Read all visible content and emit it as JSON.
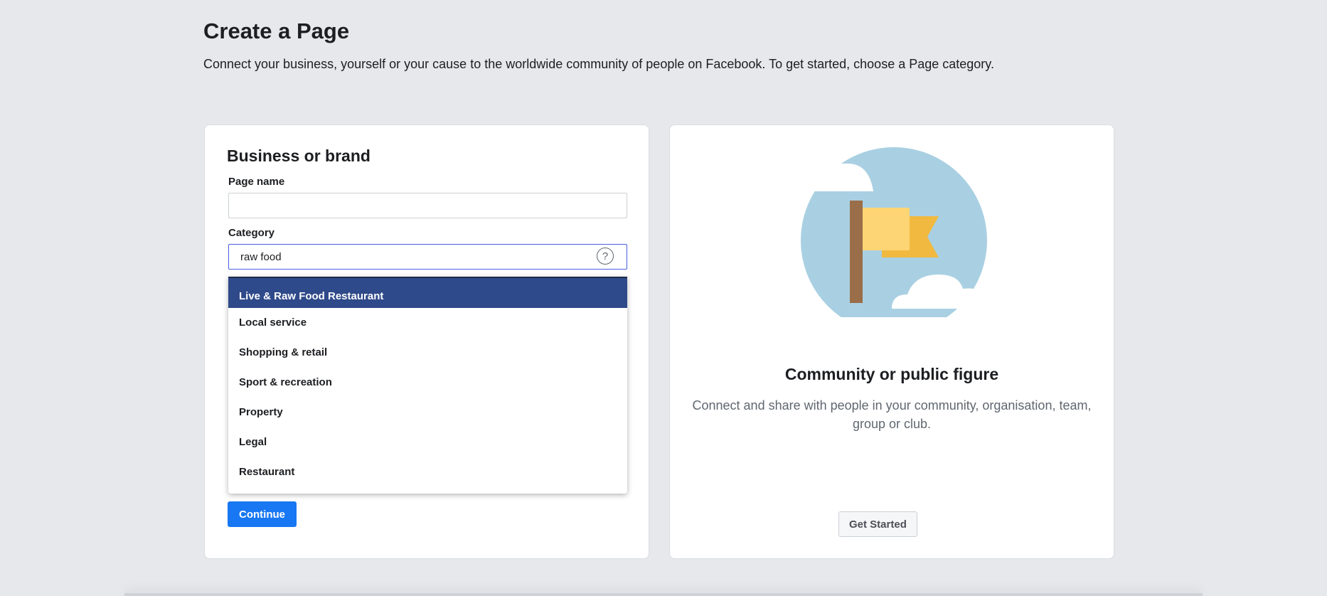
{
  "header": {
    "title": "Create a Page",
    "subtitle": "Connect your business, yourself or your cause to the worldwide community of people on Facebook. To get started, choose a Page category."
  },
  "business_card": {
    "heading": "Business or brand",
    "page_name_label": "Page name",
    "page_name_value": "",
    "category_label": "Category",
    "category_value": "raw food",
    "help_icon": "question-circle-icon",
    "dropdown": {
      "highlighted_index": 0,
      "items": [
        "Live & Raw Food Restaurant",
        "Local service",
        "Shopping & retail",
        "Sport & recreation",
        "Property",
        "Legal",
        "Restaurant"
      ]
    },
    "continue_label": "Continue"
  },
  "community_card": {
    "heading": "Community or public figure",
    "description": "Connect and share with people in your community, organisation, team, group or club.",
    "button_label": "Get Started",
    "illustration": "flag-illustration-icon"
  },
  "colors": {
    "background": "#e7e8ec",
    "primary_button": "#1877f2",
    "dropdown_highlight": "#2f4a8a",
    "illustration_circle": "#a9d0e2",
    "flag_light": "#fdd574",
    "flag_dark": "#f1b93f",
    "pole": "#9a6e48"
  }
}
